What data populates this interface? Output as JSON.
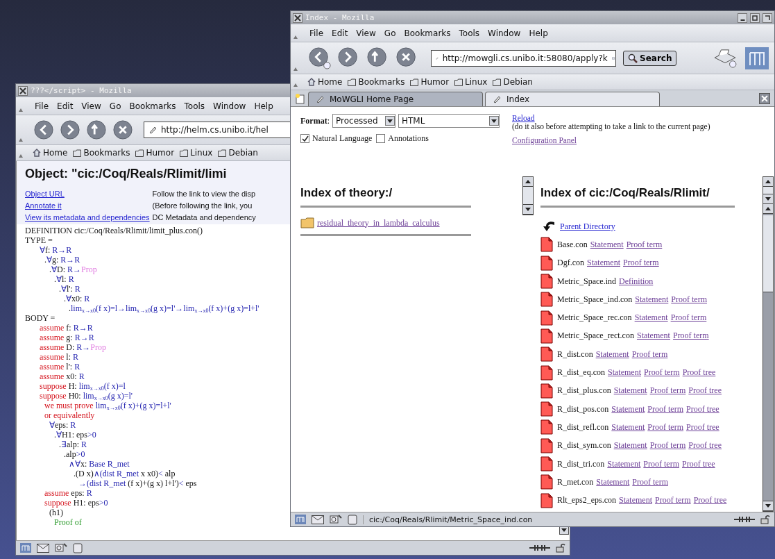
{
  "back_window": {
    "title": "???</script> - Mozilla",
    "menu": [
      "File",
      "Edit",
      "View",
      "Go",
      "Bookmarks",
      "Tools",
      "Window",
      "Help"
    ],
    "url": "http://helm.cs.unibo.it/hel",
    "bookmarks": [
      {
        "label": "Home",
        "kind": "home"
      },
      {
        "label": "Bookmarks",
        "kind": "folder"
      },
      {
        "label": "Humor",
        "kind": "folder"
      },
      {
        "label": "Linux",
        "kind": "folder"
      },
      {
        "label": "Debian",
        "kind": "folder"
      }
    ],
    "heading": "Object: \"cic:/Coq/Reals/Rlimit/limi",
    "links": [
      {
        "label": "Object URL",
        "visited": false,
        "description": "Follow the link to view the disp"
      },
      {
        "label": "Annotate it",
        "visited": false,
        "description": "(Before following the link, you"
      },
      {
        "label": "View its metadata and dependencies",
        "visited": false,
        "description": "DC Metadata and dependency"
      }
    ],
    "proof": [
      {
        "parts": [
          {
            "kind": "text",
            "text": "DEFINITION cic:/Coq/Reals/Rlimit/limit_plus.con()"
          }
        ]
      },
      {
        "parts": [
          {
            "kind": "text",
            "text": "TYPE ="
          }
        ],
        "children": [
          {
            "parts": [
              {
                "kind": "term",
                "text": "∀"
              },
              {
                "kind": "text",
                "text": "f: "
              },
              {
                "kind": "term",
                "text": "R→R"
              }
            ],
            "children": [
              {
                "parts": [
                  {
                    "kind": "text",
                    "text": "."
                  },
                  {
                    "kind": "term",
                    "text": "∀"
                  },
                  {
                    "kind": "text",
                    "text": "g: "
                  },
                  {
                    "kind": "term",
                    "text": "R→R"
                  }
                ],
                "children": [
                  {
                    "parts": [
                      {
                        "kind": "text",
                        "text": "."
                      },
                      {
                        "kind": "term",
                        "text": "∀"
                      },
                      {
                        "kind": "text",
                        "text": "D: "
                      },
                      {
                        "kind": "term",
                        "text": "R→"
                      },
                      {
                        "kind": "sort",
                        "text": "Prop"
                      }
                    ],
                    "children": [
                      {
                        "parts": [
                          {
                            "kind": "text",
                            "text": "."
                          },
                          {
                            "kind": "term",
                            "text": "∀"
                          },
                          {
                            "kind": "text",
                            "text": "l: "
                          },
                          {
                            "kind": "term",
                            "text": "R"
                          }
                        ],
                        "children": [
                          {
                            "parts": [
                              {
                                "kind": "text",
                                "text": "."
                              },
                              {
                                "kind": "term",
                                "text": "∀"
                              },
                              {
                                "kind": "text",
                                "text": "l': "
                              },
                              {
                                "kind": "term",
                                "text": "R"
                              }
                            ],
                            "children": [
                              {
                                "parts": [
                                  {
                                    "kind": "text",
                                    "text": "."
                                  },
                                  {
                                    "kind": "term",
                                    "text": "∀"
                                  },
                                  {
                                    "kind": "text",
                                    "text": "x0: "
                                  },
                                  {
                                    "kind": "term",
                                    "text": "R"
                                  }
                                ],
                                "children": [
                                  {
                                    "parts": [
                                      {
                                        "kind": "text",
                                        "text": "."
                                      },
                                      {
                                        "kind": "term",
                                        "text": "lim$_{x→x0}$(f x)=l→lim$_{x→x0}$(g x)=l'→lim$_{x→x0}$(f x)+(g x)=l+l'"
                                      }
                                    ]
                                  }
                                ]
                              }
                            ]
                          }
                        ]
                      }
                    ]
                  }
                ]
              }
            ]
          }
        ]
      },
      {
        "parts": [
          {
            "kind": "text",
            "text": "BODY ="
          }
        ],
        "children": [
          {
            "parts": [
              {
                "kind": "keyword",
                "text": "assume"
              },
              {
                "kind": "text",
                "text": " f: "
              },
              {
                "kind": "term",
                "text": "R→R"
              }
            ]
          },
          {
            "parts": [
              {
                "kind": "keyword",
                "text": "assume"
              },
              {
                "kind": "text",
                "text": " g: "
              },
              {
                "kind": "term",
                "text": "R→R"
              }
            ]
          },
          {
            "parts": [
              {
                "kind": "keyword",
                "text": "assume"
              },
              {
                "kind": "text",
                "text": " D: "
              },
              {
                "kind": "term",
                "text": "R→"
              },
              {
                "kind": "sort",
                "text": "Prop"
              }
            ]
          },
          {
            "parts": [
              {
                "kind": "keyword",
                "text": "assume"
              },
              {
                "kind": "text",
                "text": " l: "
              },
              {
                "kind": "term",
                "text": "R"
              }
            ]
          },
          {
            "parts": [
              {
                "kind": "keyword",
                "text": "assume"
              },
              {
                "kind": "text",
                "text": " l': "
              },
              {
                "kind": "term",
                "text": "R"
              }
            ]
          },
          {
            "parts": [
              {
                "kind": "keyword",
                "text": "assume"
              },
              {
                "kind": "text",
                "text": " x0: "
              },
              {
                "kind": "term",
                "text": "R"
              }
            ]
          },
          {
            "parts": [
              {
                "kind": "keyword",
                "text": "suppose"
              },
              {
                "kind": "text",
                "text": " H: "
              },
              {
                "kind": "term",
                "text": "lim$_{x→x0}$(f x)=l"
              }
            ]
          },
          {
            "parts": [
              {
                "kind": "keyword",
                "text": "suppose"
              },
              {
                "kind": "text",
                "text": " H0: "
              },
              {
                "kind": "term",
                "text": "lim$_{x→x0}$(g x)=l'"
              }
            ],
            "children": [
              {
                "parts": [
                  {
                    "kind": "keyword",
                    "text": "we must prove "
                  },
                  {
                    "kind": "term",
                    "text": "lim$_{x→x0}$(f x)+(g x)=l+l'"
                  }
                ]
              },
              {
                "parts": [
                  {
                    "kind": "keyword",
                    "text": "or equivalently"
                  }
                ],
                "children": [
                  {
                    "parts": [
                      {
                        "kind": "term",
                        "text": "∀"
                      },
                      {
                        "kind": "text",
                        "text": "eps: "
                      },
                      {
                        "kind": "term",
                        "text": "R"
                      }
                    ],
                    "children": [
                      {
                        "parts": [
                          {
                            "kind": "text",
                            "text": "."
                          },
                          {
                            "kind": "term",
                            "text": "∀"
                          },
                          {
                            "kind": "text",
                            "text": "H1: eps"
                          },
                          {
                            "kind": "term",
                            "text": ">0"
                          }
                        ],
                        "children": [
                          {
                            "parts": [
                              {
                                "kind": "text",
                                "text": "."
                              },
                              {
                                "kind": "term",
                                "text": "∃"
                              },
                              {
                                "kind": "text",
                                "text": "alp: "
                              },
                              {
                                "kind": "term",
                                "text": "R"
                              }
                            ],
                            "children": [
                              {
                                "parts": [
                                  {
                                    "kind": "text",
                                    "text": ".alp"
                                  },
                                  {
                                    "kind": "term",
                                    "text": ">0"
                                  }
                                ],
                                "children": [
                                  {
                                    "parts": [
                                      {
                                        "kind": "term",
                                        "text": "∧∀"
                                      },
                                      {
                                        "kind": "text",
                                        "text": "x: "
                                      },
                                      {
                                        "kind": "term",
                                        "text": "Base R_met"
                                      }
                                    ],
                                    "children": [
                                      {
                                        "parts": [
                                          {
                                            "kind": "text",
                                            "text": ".(D x)"
                                          },
                                          {
                                            "kind": "term",
                                            "text": "∧(dist R_met"
                                          },
                                          {
                                            "kind": "text",
                                            "text": " x x0)"
                                          },
                                          {
                                            "kind": "term",
                                            "text": "<"
                                          },
                                          {
                                            "kind": "text",
                                            "text": " alp"
                                          }
                                        ],
                                        "children": [
                                          {
                                            "parts": [
                                              {
                                                "kind": "term",
                                                "text": "→(dist R_met"
                                              },
                                              {
                                                "kind": "text",
                                                "text": " (f x)+(g x) l+l')"
                                              },
                                              {
                                                "kind": "term",
                                                "text": "<"
                                              },
                                              {
                                                "kind": "text",
                                                "text": " eps"
                                              }
                                            ]
                                          }
                                        ]
                                      }
                                    ]
                                  }
                                ]
                              }
                            ]
                          }
                        ]
                      }
                    ]
                  }
                ]
              },
              {
                "parts": [
                  {
                    "kind": "keyword",
                    "text": "assume"
                  },
                  {
                    "kind": "text",
                    "text": " eps: "
                  },
                  {
                    "kind": "term",
                    "text": "R"
                  }
                ]
              },
              {
                "parts": [
                  {
                    "kind": "keyword",
                    "text": "suppose"
                  },
                  {
                    "kind": "text",
                    "text": " H1: eps"
                  },
                  {
                    "kind": "term",
                    "text": ">0"
                  }
                ],
                "children": [
                  {
                    "parts": [
                      {
                        "kind": "text",
                        "text": "(h1)"
                      }
                    ],
                    "children": [
                      {
                        "parts": [
                          {
                            "kind": "comment",
                            "text": "Proof of"
                          }
                        ]
                      }
                    ]
                  }
                ]
              }
            ]
          }
        ]
      }
    ]
  },
  "front_window": {
    "title": "Index - Mozilla",
    "menu": [
      "File",
      "Edit",
      "View",
      "Go",
      "Bookmarks",
      "Tools",
      "Window",
      "Help"
    ],
    "url": "http://mowgli.cs.unibo.it:58080/apply?k",
    "search_button": "Search",
    "bookmarks": [
      {
        "label": "Home",
        "kind": "home"
      },
      {
        "label": "Bookmarks",
        "kind": "folder"
      },
      {
        "label": "Humor",
        "kind": "folder"
      },
      {
        "label": "Linux",
        "kind": "folder"
      },
      {
        "label": "Debian",
        "kind": "folder"
      }
    ],
    "tabs": [
      {
        "label": "MoWGLI Home Page",
        "selected": false
      },
      {
        "label": "Index",
        "selected": true
      }
    ],
    "form": {
      "format_label": "**Format**:",
      "selects": [
        "Processed",
        "HTML"
      ],
      "options": [
        {
          "label": "Natural Language",
          "checked": true
        },
        {
          "label": "Annotations",
          "checked": false
        }
      ],
      "reload_link": {
        "label": "Reload",
        "visited": false
      },
      "reload_note": "(do it also before attempting to take a link to the current page)",
      "config_link": {
        "label": "Configuration Panel",
        "visited": true
      }
    },
    "theory_index": {
      "heading": "Index of theory:/",
      "items": [
        {
          "label": "residual_theory_in_lambda_calculus",
          "visited": true
        }
      ]
    },
    "object_index": {
      "heading": "Index of cic:/Coq/Reals/Rlimit/",
      "entries": [
        {
          "kind": "parent",
          "links": [
            {
              "label": "Parent Directory",
              "visited": false
            }
          ]
        },
        {
          "kind": "file",
          "name": "Base.con",
          "links": [
            {
              "label": "Statement",
              "visited": true
            },
            {
              "label": "Proof term",
              "visited": true
            }
          ]
        },
        {
          "kind": "file",
          "name": "Dgf.con",
          "links": [
            {
              "label": "Statement",
              "visited": true
            },
            {
              "label": "Proof term",
              "visited": true
            }
          ]
        },
        {
          "kind": "file",
          "name": "Metric_Space.ind",
          "links": [
            {
              "label": "Definition",
              "visited": true
            }
          ]
        },
        {
          "kind": "file",
          "name": "Metric_Space_ind.con",
          "links": [
            {
              "label": "Statement",
              "visited": true
            },
            {
              "label": "Proof term",
              "visited": true
            }
          ]
        },
        {
          "kind": "file",
          "name": "Metric_Space_rec.con",
          "links": [
            {
              "label": "Statement",
              "visited": true
            },
            {
              "label": "Proof term",
              "visited": true
            }
          ]
        },
        {
          "kind": "file",
          "name": "Metric_Space_rect.con",
          "links": [
            {
              "label": "Statement",
              "visited": true
            },
            {
              "label": "Proof term",
              "visited": true
            }
          ]
        },
        {
          "kind": "file",
          "name": "R_dist.con",
          "links": [
            {
              "label": "Statement",
              "visited": true
            },
            {
              "label": "Proof term",
              "visited": true
            }
          ]
        },
        {
          "kind": "file",
          "name": "R_dist_eq.con",
          "links": [
            {
              "label": "Statement",
              "visited": true
            },
            {
              "label": "Proof term",
              "visited": true
            },
            {
              "label": "Proof tree",
              "visited": true
            }
          ]
        },
        {
          "kind": "file",
          "name": "R_dist_plus.con",
          "links": [
            {
              "label": "Statement",
              "visited": true
            },
            {
              "label": "Proof term",
              "visited": true
            },
            {
              "label": "Proof tree",
              "visited": true
            }
          ]
        },
        {
          "kind": "file",
          "name": "R_dist_pos.con",
          "links": [
            {
              "label": "Statement",
              "visited": true
            },
            {
              "label": "Proof term",
              "visited": true
            },
            {
              "label": "Proof tree",
              "visited": true
            }
          ]
        },
        {
          "kind": "file",
          "name": "R_dist_refl.con",
          "links": [
            {
              "label": "Statement",
              "visited": true
            },
            {
              "label": "Proof term",
              "visited": true
            },
            {
              "label": "Proof tree",
              "visited": true
            }
          ]
        },
        {
          "kind": "file",
          "name": "R_dist_sym.con",
          "links": [
            {
              "label": "Statement",
              "visited": true
            },
            {
              "label": "Proof term",
              "visited": true
            },
            {
              "label": "Proof tree",
              "visited": true
            }
          ]
        },
        {
          "kind": "file",
          "name": "R_dist_tri.con",
          "links": [
            {
              "label": "Statement",
              "visited": true
            },
            {
              "label": "Proof term",
              "visited": true
            },
            {
              "label": "Proof tree",
              "visited": true
            }
          ]
        },
        {
          "kind": "file",
          "name": "R_met.con",
          "links": [
            {
              "label": "Statement",
              "visited": true
            },
            {
              "label": "Proof term",
              "visited": true
            }
          ]
        },
        {
          "kind": "file",
          "name": "Rlt_eps2_eps.con",
          "links": [
            {
              "label": "Statement",
              "visited": true
            },
            {
              "label": "Proof term",
              "visited": true
            },
            {
              "label": "Proof tree",
              "visited": true
            }
          ]
        }
      ]
    },
    "status_text": "cic:/Coq/Reals/Rlimit/Metric_Space_ind.con"
  }
}
